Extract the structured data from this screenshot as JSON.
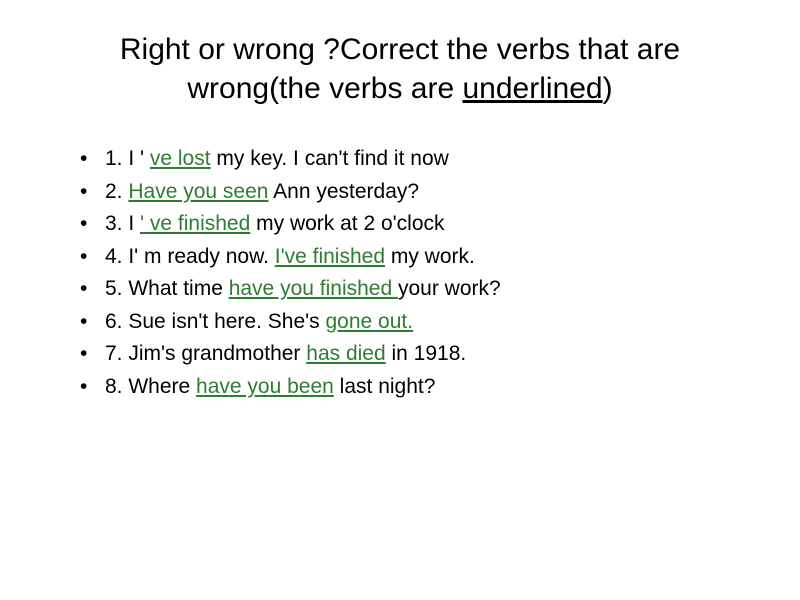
{
  "title": {
    "part1": "Right or wrong ?Correct the verbs  that are wrong(the verbs are ",
    "underlined": "underlined",
    "part2": ")"
  },
  "items": [
    {
      "prefix": "1. I ' ",
      "verb": "ve lost",
      "suffix": " my key. I can't find it now"
    },
    {
      "prefix": "2. ",
      "verb": "Have you seen",
      "suffix": " Ann yesterday?"
    },
    {
      "prefix": "3. I ",
      "verb": "' ve finished",
      "suffix": " my work at  2 o'clock"
    },
    {
      "prefix": "4. I' m ready now. ",
      "verb": "I've finished",
      "suffix": " my work."
    },
    {
      "prefix": "5. What time ",
      "verb": "have you finished ",
      "suffix": "your work?"
    },
    {
      "prefix": "6. Sue isn't here. She's ",
      "verb": "gone out.",
      "suffix": ""
    },
    {
      "prefix": "7. Jim's grandmother ",
      "verb": "has died",
      "suffix": " in 1918."
    },
    {
      "prefix": "8. Where ",
      "verb": "have you been",
      "suffix": " last night?"
    }
  ]
}
